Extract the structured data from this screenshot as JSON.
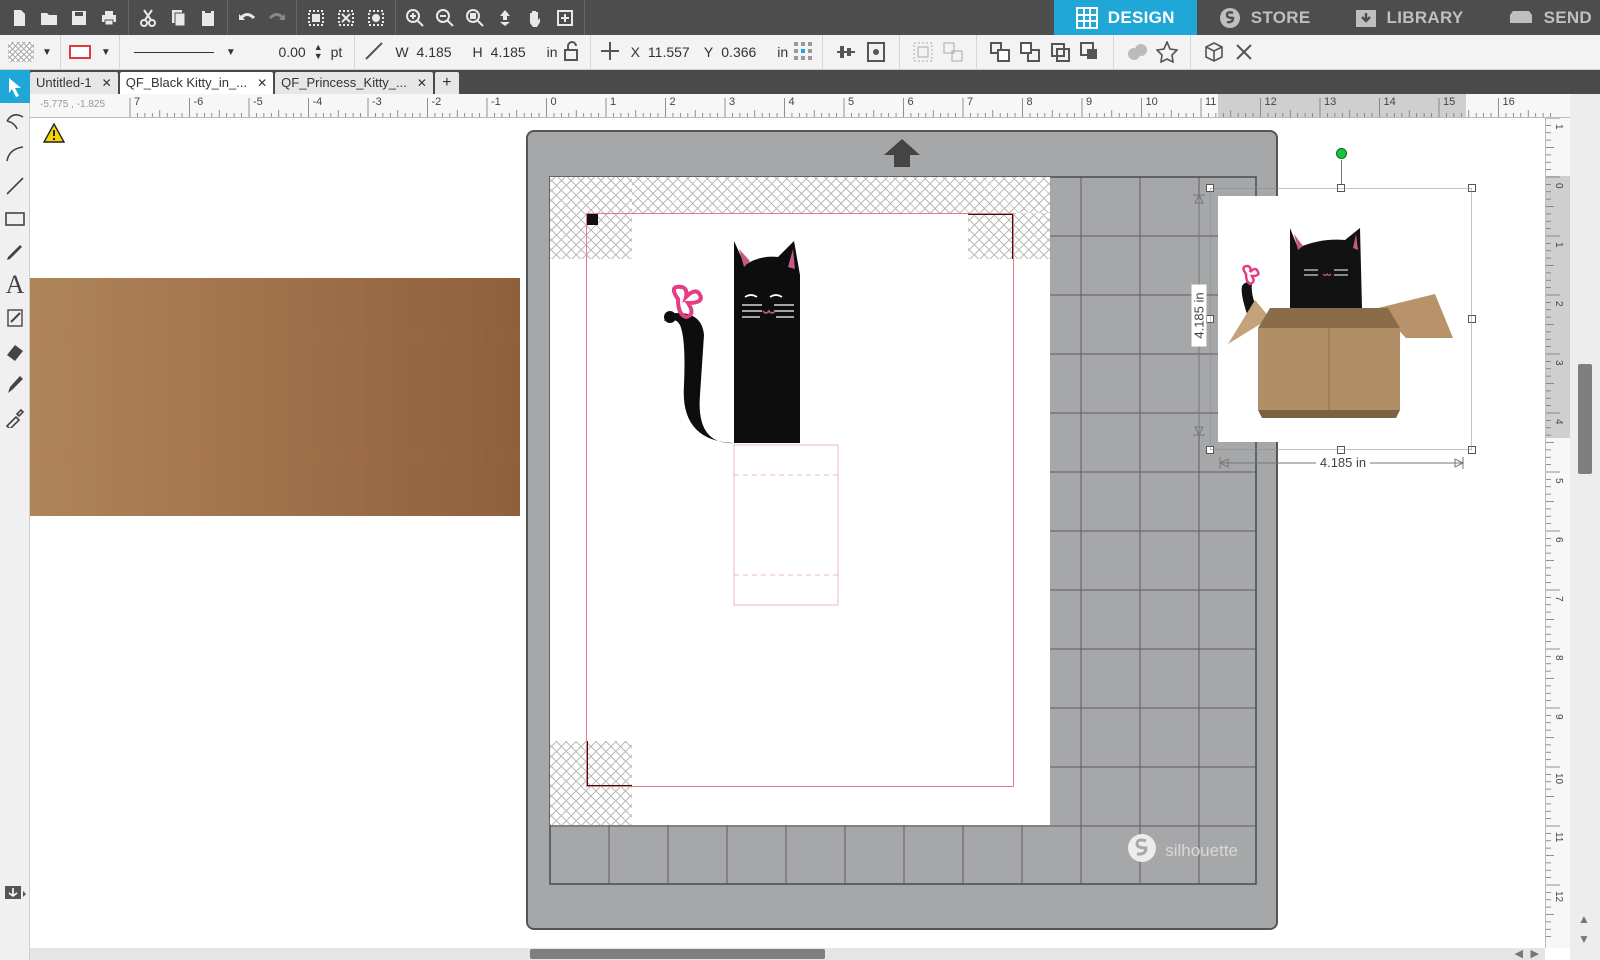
{
  "nav": {
    "design": "DESIGN",
    "store": "STORE",
    "library": "LIBRARY",
    "send": "SEND"
  },
  "propbar": {
    "line_width": "0.00",
    "line_unit": "pt",
    "w_label": "W",
    "w_value": "4.185",
    "h_label": "H",
    "h_value": "4.185",
    "size_unit": "in",
    "x_label": "X",
    "x_value": "11.557",
    "y_label": "Y",
    "y_value": "0.366",
    "pos_unit": "in"
  },
  "doc_tabs": [
    {
      "label": "Untitled-1"
    },
    {
      "label": "QF_Black Kitty_in_..."
    },
    {
      "label": "QF_Princess_Kitty_..."
    }
  ],
  "ruler": {
    "coords": "-5.775 , -1.825",
    "h_labels": [
      "7",
      "-6",
      "-5",
      "-4",
      "-3",
      "-2",
      "-1",
      "0",
      "1",
      "2",
      "3",
      "4",
      "5",
      "6",
      "7",
      "8",
      "9",
      "10",
      "11",
      "12",
      "13",
      "14",
      "15",
      "16"
    ],
    "v_labels": [
      "1",
      "0",
      "1",
      "2",
      "3",
      "4",
      "5",
      "6",
      "7",
      "8",
      "9",
      "10",
      "11",
      "12"
    ]
  },
  "mat": {
    "brand": "silhouette"
  },
  "selection": {
    "width_label": "4.185 in",
    "height_label": "4.185 in"
  },
  "colors": {
    "accent": "#1fa7d8",
    "toolbar": "#4d4d4d",
    "mat": "#a6a7a9",
    "cut_line": "#e67a85",
    "cardboard": "#b08459"
  }
}
